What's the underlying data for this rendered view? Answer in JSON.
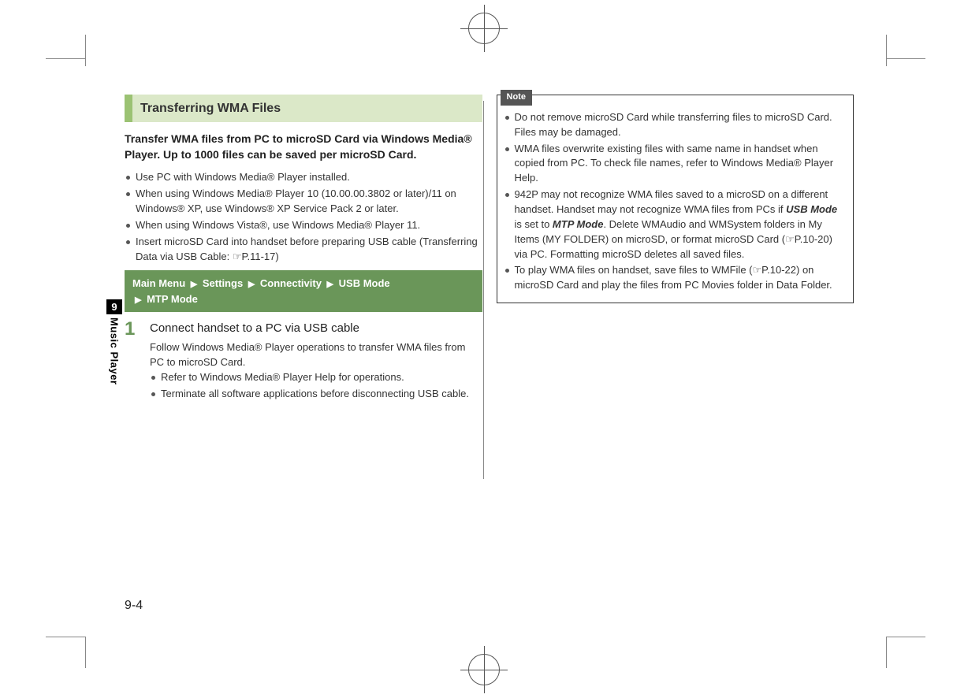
{
  "sideTab": {
    "num": "9",
    "label": "Music Player"
  },
  "pageNum": "9-4",
  "left": {
    "header": "Transferring WMA Files",
    "intro": "Transfer WMA files from PC to microSD Card via Windows Media® Player. Up to 1000 files can be saved per microSD Card.",
    "bullets": [
      "Use PC with Windows Media® Player installed.",
      "When using Windows Media® Player 10 (10.00.00.3802 or later)/11 on Windows® XP, use Windows® XP Service Pack 2 or later.",
      "When using Windows Vista®, use Windows Media® Player 11.",
      "Insert microSD Card into handset before preparing USB cable (Transferring Data via USB Cable: ☞P.11-17)"
    ],
    "menu": {
      "p1": "Main Menu",
      "p2": "Settings",
      "p3": "Connectivity",
      "p4": "USB Mode",
      "p5": "MTP Mode"
    },
    "step": {
      "num": "1",
      "title": "Connect handset to a PC via USB cable",
      "desc": "Follow Windows Media® Player operations to transfer WMA files from PC to microSD Card.",
      "sub": [
        "Refer to Windows Media® Player Help for operations.",
        "Terminate all software applications before disconnecting USB cable."
      ]
    }
  },
  "right": {
    "noteLabel": "Note",
    "notes": {
      "n1": "Do not remove microSD Card while transferring files to microSD Card. Files may be damaged.",
      "n2": "WMA files overwrite existing files with same name in handset when copied from PC. To check file names, refer to Windows Media® Player Help.",
      "n3a": "942P may not recognize WMA files saved to a microSD on a different handset. Handset may not recognize WMA files from PCs if ",
      "n3b": "USB Mode",
      "n3c": " is set to ",
      "n3d": "MTP Mode",
      "n3e": ". Delete WMAudio and WMSystem folders in My Items (MY FOLDER) on microSD, or format microSD Card (☞P.10-20) via PC. Formatting microSD deletes all saved files.",
      "n4": "To play WMA files on handset, save files to WMFile (☞P.10-22) on microSD Card and play the files from PC Movies folder in Data Folder."
    }
  }
}
